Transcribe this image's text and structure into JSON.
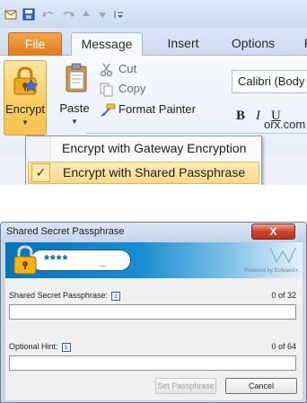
{
  "outlook": {
    "tabs": {
      "file": "File",
      "message": "Message",
      "insert": "Insert",
      "options": "Options",
      "more": "F"
    },
    "encrypt_label": "Encrypt",
    "paste_label": "Paste",
    "clipboard": {
      "cut": "Cut",
      "copy": "Copy",
      "format_painter": "Format Painter"
    },
    "font_name": "Calibri (Body",
    "format_buttons": {
      "bold": "B",
      "italic": "I",
      "underline": "U"
    },
    "address_fragment": "orx.com",
    "encrypt_menu": {
      "items": [
        {
          "label": "Encrypt with Gateway Encryption",
          "checked": false
        },
        {
          "label": "Encrypt with Shared Passphrase",
          "checked": true
        }
      ],
      "check_glyph": "✓"
    }
  },
  "dialog": {
    "title": "Shared Secret Passphrase",
    "close_glyph": "X",
    "banner": {
      "masked_password": "****",
      "cursor": "_",
      "powered_by": "Powered by Echoworx"
    },
    "passphrase": {
      "label": "Shared Secret Passphrase:",
      "info_glyph": "i",
      "counter": "0 of 32",
      "value": ""
    },
    "hint": {
      "label": "Optional Hint:",
      "info_glyph": "i",
      "counter": "0 of 64",
      "value": ""
    },
    "buttons": {
      "set": "Set Passphrase",
      "cancel": "Cancel"
    }
  },
  "colors": {
    "accent_orange": "#e07a18",
    "menu_highlight": "#fbd88a",
    "banner_blue": "#0a73b8",
    "close_red": "#c9452b"
  }
}
